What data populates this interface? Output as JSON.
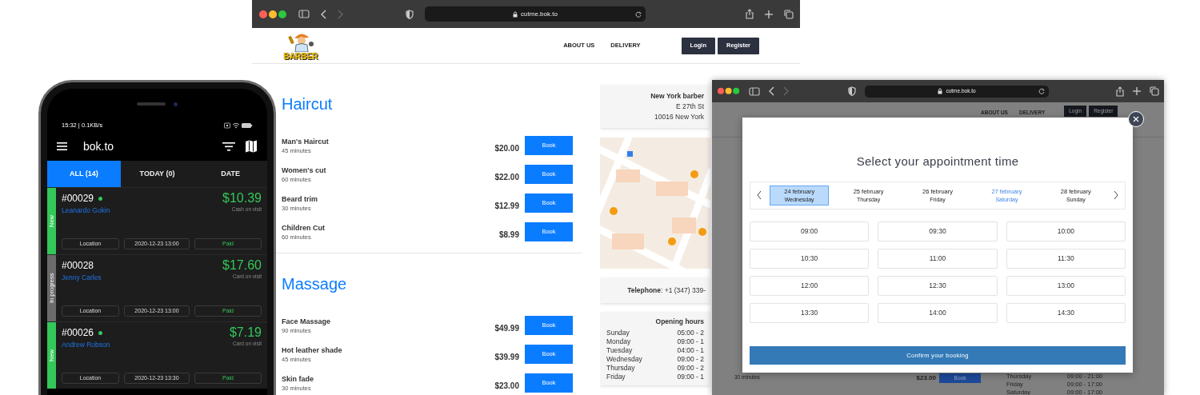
{
  "phone_app": {
    "status_bar": {
      "time": "15:32 | 0.1KB/s"
    },
    "app_bar": {
      "title": "bok.to"
    },
    "tabs": [
      {
        "label": "ALL (14)",
        "selected": true
      },
      {
        "label": "TODAY (0)",
        "selected": false
      },
      {
        "label": "DATE",
        "selected": false
      }
    ],
    "orders": [
      {
        "number": "#00029",
        "online": true,
        "customer": "Leanardo Gokin",
        "amount": "$10.39",
        "payment": "Cash on visit",
        "status": "New",
        "color": "#34c759",
        "location": "Location",
        "date": "2020-12-23 13:00",
        "payment_status": "Paid"
      },
      {
        "number": "#00028",
        "online": false,
        "customer": "Jenny Carles",
        "amount": "$17.60",
        "payment": "Card on visit",
        "status": "In progress",
        "color": "#6b6b6b",
        "location": "Location",
        "date": "2020-12-23 13:00",
        "payment_status": "Paid"
      },
      {
        "number": "#00026",
        "online": true,
        "customer": "Andrew Robson",
        "amount": "$7.19",
        "payment": "Card on visit",
        "status": "New",
        "color": "#34c759",
        "location": "Location",
        "date": "2020-12-23 13:30",
        "payment_status": "Paid"
      }
    ]
  },
  "barber_site": {
    "browser": {
      "url": "cutme.bok.to"
    },
    "logo_text": "BARBER",
    "nav_links": [
      "ABOUT US",
      "DELIVERY"
    ],
    "buttons": [
      "Login",
      "Register"
    ],
    "categories": [
      {
        "title": "Haircut",
        "services": [
          {
            "name": "Man's Haircut",
            "duration": "45 minutes",
            "price": "$20.00",
            "action": "Book"
          },
          {
            "name": "Women's cut",
            "duration": "60 minutes",
            "price": "$22.00",
            "action": "Book"
          },
          {
            "name": "Beard trim",
            "duration": "30 minutes",
            "price": "$12.99",
            "action": "Book"
          },
          {
            "name": "Children Cut",
            "duration": "60 minutes",
            "price": "$8.99",
            "action": "Book"
          }
        ]
      },
      {
        "title": "Massage",
        "services": [
          {
            "name": "Face Massage",
            "duration": "90 minutes",
            "price": "$49.99",
            "action": "Book"
          },
          {
            "name": "Hot leather shade",
            "duration": "45 minutes",
            "price": "$39.99",
            "action": "Book"
          },
          {
            "name": "Skin fade",
            "duration": "30 minutes",
            "price": "$23.00",
            "action": "Book"
          }
        ]
      }
    ],
    "sidebar": {
      "address": [
        "New York barber",
        "E 27th St",
        "10016 New York"
      ],
      "telephone": "**Telephone**: +1 (347) 339-",
      "hours_title": "Opening hours",
      "hours": [
        {
          "day": "Sunday",
          "time": "05:00 - 2"
        },
        {
          "day": "Monday",
          "time": "09:00 - 1"
        },
        {
          "day": "Tuesday",
          "time": "04:00 - 1"
        },
        {
          "day": "Wednesday",
          "time": "09:00 - 2"
        },
        {
          "day": "Thursday",
          "time": "09:00 - 2"
        },
        {
          "day": "Friday",
          "time": "09:00 - 1"
        }
      ]
    }
  },
  "booking_window": {
    "browser": {
      "url": "cutme.bok.to"
    },
    "background_page": {
      "nav_links": [
        "ABOUT US",
        "DELIVERY"
      ],
      "buttons": [
        "Login",
        "Register"
      ],
      "service": {
        "duration": "30 minutes",
        "price": "$23.00",
        "action": "Book"
      },
      "hours": [
        {
          "day": "Thursday",
          "time": "09:00 - 21:00"
        },
        {
          "day": "Friday",
          "time": "09:00 - 17:00"
        },
        {
          "day": "Saturday",
          "time": "09:00 - 17:00"
        }
      ]
    },
    "modal": {
      "title": "Select your appointment time",
      "days": [
        {
          "date": "24 february",
          "weekday": "Wednesday",
          "selected": true,
          "highlighted": false
        },
        {
          "date": "25 february",
          "weekday": "Thursday",
          "selected": false,
          "highlighted": false
        },
        {
          "date": "26 february",
          "weekday": "Friday",
          "selected": false,
          "highlighted": false
        },
        {
          "date": "27 february",
          "weekday": "Saturday",
          "selected": false,
          "highlighted": true
        },
        {
          "date": "28 february",
          "weekday": "Sunday",
          "selected": false,
          "highlighted": false
        }
      ],
      "slots": [
        "09:00",
        "09:30",
        "10:00",
        "10:30",
        "11:00",
        "11:30",
        "12:00",
        "12:30",
        "13:00",
        "13:30",
        "14:00",
        "14:30"
      ],
      "confirm": "Confirm your booking"
    }
  }
}
